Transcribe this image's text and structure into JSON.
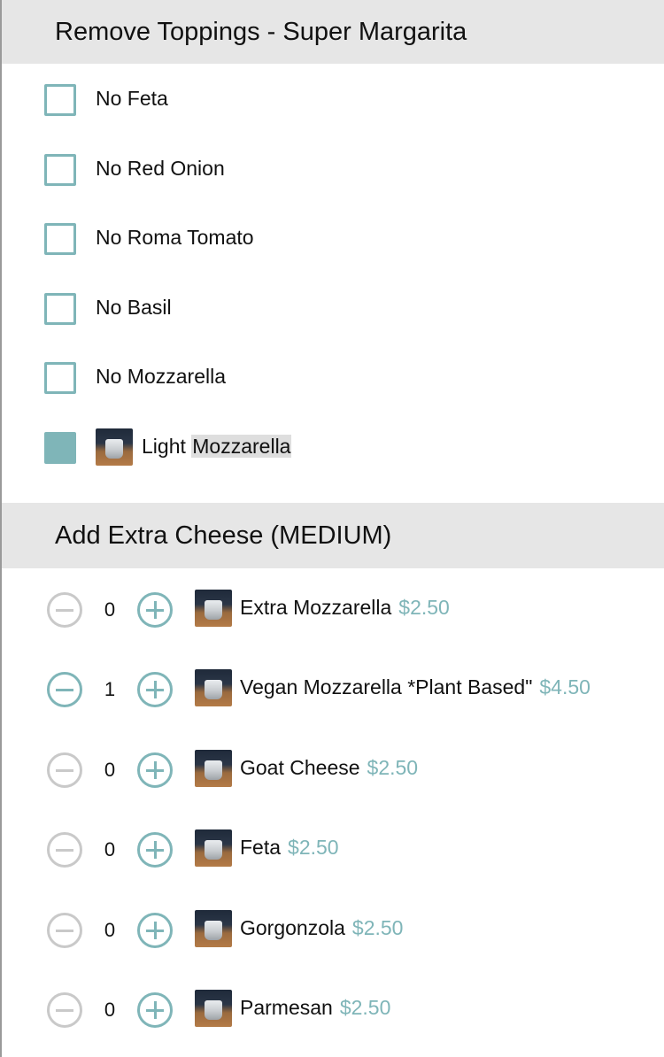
{
  "remove_section": {
    "title": "Remove Toppings - Super Margarita",
    "items": [
      {
        "label": "No Feta",
        "checked": false
      },
      {
        "label": "No Red Onion",
        "checked": false
      },
      {
        "label": "No Roma Tomato",
        "checked": false
      },
      {
        "label": "No Basil",
        "checked": false
      },
      {
        "label": "No Mozzarella",
        "checked": false
      }
    ],
    "light_item": {
      "label_prefix": "Light",
      "label_highlight": "Mozzarella",
      "checked": true
    }
  },
  "add_section": {
    "title": "Add Extra Cheese (MEDIUM)",
    "items": [
      {
        "label": "Extra Mozzarella",
        "price": "$2.50",
        "qty": "0"
      },
      {
        "label": "Vegan Mozzarella *Plant Based\"",
        "price": "$4.50",
        "qty": "1"
      },
      {
        "label": "Goat Cheese",
        "price": "$2.50",
        "qty": "0"
      },
      {
        "label": "Feta",
        "price": "$2.50",
        "qty": "0"
      },
      {
        "label": "Gorgonzola",
        "price": "$2.50",
        "qty": "0"
      },
      {
        "label": "Parmesan",
        "price": "$2.50",
        "qty": "0"
      }
    ]
  },
  "colors": {
    "accent": "#7fb5b8",
    "disabled": "#c9c9c9",
    "header_bg": "#e6e6e6"
  },
  "icons": {
    "minus": "minus-circle-icon",
    "plus": "plus-circle-icon",
    "checkbox": "checkbox-icon"
  }
}
